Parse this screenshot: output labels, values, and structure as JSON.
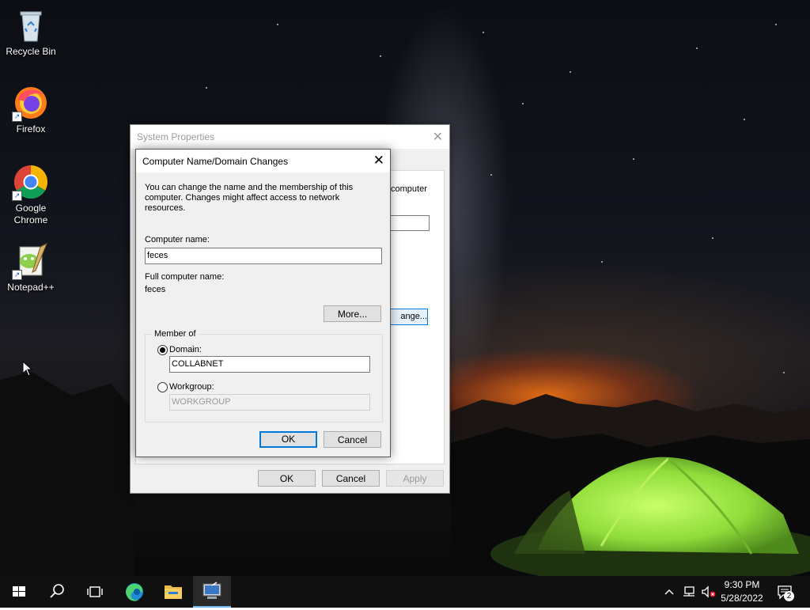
{
  "desktop": {
    "icons": [
      {
        "name": "recycle-bin",
        "label": "Recycle Bin"
      },
      {
        "name": "firefox",
        "label": "Firefox"
      },
      {
        "name": "google-chrome",
        "label": "Google Chrome"
      },
      {
        "name": "notepad-plus-plus",
        "label": "Notepad++"
      }
    ]
  },
  "system_properties": {
    "title": "System Properties",
    "partial_text": "computer",
    "partial_change_button": "ange...",
    "ok_label": "OK",
    "cancel_label": "Cancel",
    "apply_label": "Apply"
  },
  "domain_dialog": {
    "title": "Computer Name/Domain Changes",
    "description": "You can change the name and the membership of this computer. Changes might affect access to network resources.",
    "computer_name_label": "Computer name:",
    "computer_name_value": "feces",
    "full_name_label": "Full computer name:",
    "full_name_value": "feces",
    "more_button": "More...",
    "member_of_label": "Member of",
    "domain_label": "Domain:",
    "domain_value": "COLLABNET",
    "domain_selected": true,
    "workgroup_label": "Workgroup:",
    "workgroup_value": "WORKGROUP",
    "ok_label": "OK",
    "cancel_label": "Cancel"
  },
  "taskbar": {
    "items": [
      "start",
      "search",
      "task-view",
      "edge",
      "file-explorer",
      "system-properties"
    ],
    "active_item": "system-properties",
    "clock_time": "9:30 PM",
    "clock_date": "5/28/2022",
    "notification_count": "2"
  },
  "colors": {
    "accent": "#0078d7",
    "taskbar": "#101010",
    "tent_green": "#8fdc3a"
  }
}
